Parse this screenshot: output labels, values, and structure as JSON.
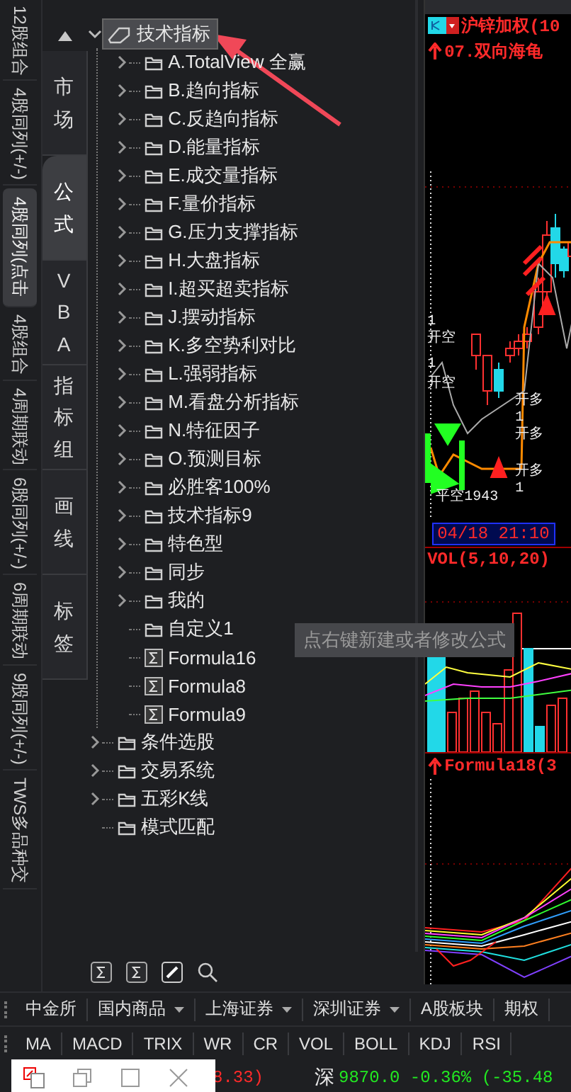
{
  "side_tabs": [
    {
      "label": "12股组合",
      "selected": false
    },
    {
      "label": "4股同列(+/-)",
      "selected": false
    },
    {
      "label": "4股同列(点击",
      "selected": true
    },
    {
      "label": "4股组合",
      "selected": false
    },
    {
      "label": "4周期联动",
      "selected": false
    },
    {
      "label": "6股同列(+/-)",
      "selected": false
    },
    {
      "label": "6周期联动",
      "selected": false
    },
    {
      "label": "9股同列(+/-)",
      "selected": false
    },
    {
      "label": "TWS多品种交",
      "selected": false
    }
  ],
  "panel_tabs": [
    {
      "label": "市场",
      "selected": false
    },
    {
      "label": "公式",
      "selected": true
    },
    {
      "label": "VBA",
      "selected": false
    },
    {
      "label": "指标组",
      "selected": false
    },
    {
      "label": "画线",
      "selected": false
    },
    {
      "label": "标签",
      "selected": false
    }
  ],
  "tree": [
    {
      "label": "技术指标",
      "kind": "category",
      "expandable": true,
      "expanded": true,
      "selected": true,
      "children": [
        {
          "label": "A.TotalView 全赢",
          "kind": "folder",
          "expandable": true,
          "selected": false
        },
        {
          "label": "B.趋向指标",
          "kind": "folder",
          "expandable": true,
          "selected": false
        },
        {
          "label": "C.反趋向指标",
          "kind": "folder",
          "expandable": true,
          "selected": false
        },
        {
          "label": "D.能量指标",
          "kind": "folder",
          "expandable": true,
          "selected": false
        },
        {
          "label": "E.成交量指标",
          "kind": "folder",
          "expandable": true,
          "selected": false
        },
        {
          "label": "F.量价指标",
          "kind": "folder",
          "expandable": true,
          "selected": false
        },
        {
          "label": "G.压力支撑指标",
          "kind": "folder",
          "expandable": true,
          "selected": false
        },
        {
          "label": "H.大盘指标",
          "kind": "folder",
          "expandable": true,
          "selected": false
        },
        {
          "label": "I.超买超卖指标",
          "kind": "folder",
          "expandable": true,
          "selected": false
        },
        {
          "label": "J.摆动指标",
          "kind": "folder",
          "expandable": true,
          "selected": false
        },
        {
          "label": "K.多空势利对比",
          "kind": "folder",
          "expandable": true,
          "selected": false
        },
        {
          "label": "L.强弱指标",
          "kind": "folder",
          "expandable": true,
          "selected": false
        },
        {
          "label": "M.看盘分析指标",
          "kind": "folder",
          "expandable": true,
          "selected": false
        },
        {
          "label": "N.特征因子",
          "kind": "folder",
          "expandable": true,
          "selected": false
        },
        {
          "label": "O.预测目标",
          "kind": "folder",
          "expandable": true,
          "selected": false
        },
        {
          "label": "必胜客100%",
          "kind": "folder",
          "expandable": true,
          "selected": false
        },
        {
          "label": "技术指标9",
          "kind": "folder",
          "expandable": true,
          "selected": false
        },
        {
          "label": "特色型",
          "kind": "folder",
          "expandable": true,
          "selected": false
        },
        {
          "label": "同步",
          "kind": "folder",
          "expandable": true,
          "selected": false
        },
        {
          "label": "我的",
          "kind": "folder",
          "expandable": true,
          "selected": false
        },
        {
          "label": "自定义1",
          "kind": "folder",
          "expandable": false,
          "selected": false
        },
        {
          "label": "Formula16",
          "kind": "formula",
          "expandable": false,
          "selected": false
        },
        {
          "label": "Formula8",
          "kind": "formula",
          "expandable": false,
          "selected": false
        },
        {
          "label": "Formula9",
          "kind": "formula",
          "expandable": false,
          "selected": false
        }
      ]
    },
    {
      "label": "条件选股",
      "kind": "folder",
      "expandable": true,
      "expanded": false,
      "selected": false
    },
    {
      "label": "交易系统",
      "kind": "folder",
      "expandable": true,
      "expanded": false,
      "selected": false
    },
    {
      "label": "五彩K线",
      "kind": "folder",
      "expandable": true,
      "expanded": false,
      "selected": false
    },
    {
      "label": "模式匹配",
      "kind": "folder",
      "expandable": false,
      "selected": false
    }
  ],
  "tooltip": "点右键新建或者修改公式",
  "chart": {
    "symbol": "沪锌加权(10",
    "indicator": "07.双向海龟",
    "time": "04/18 21:10",
    "volume_label": "VOL(5,10,20)",
    "formula_label": "Formula18(3",
    "markers": [
      "1",
      "开空",
      "1",
      "开空",
      "平空1943",
      "开多",
      "1",
      "开多",
      "开多",
      "1"
    ]
  },
  "market_tabs": [
    {
      "label": "中金所",
      "dropdown": false
    },
    {
      "label": "国内商品",
      "dropdown": true
    },
    {
      "label": "上海证券",
      "dropdown": true
    },
    {
      "label": "深圳证券",
      "dropdown": true
    },
    {
      "label": "A股板块",
      "dropdown": false
    },
    {
      "label": "期权",
      "dropdown": false
    }
  ],
  "indicator_tabs": [
    "MA",
    "MACD",
    "TRIX",
    "WR",
    "CR",
    "VOL",
    "BOLL",
    "KDJ",
    "RSI"
  ],
  "status": [
    {
      "text": "8.33)",
      "color": "#ff2a2a"
    },
    {
      "text": "深",
      "color": "#e8e8e8"
    },
    {
      "text": "9870.0 -0.36% (-35.48",
      "color": "#22e822"
    }
  ]
}
